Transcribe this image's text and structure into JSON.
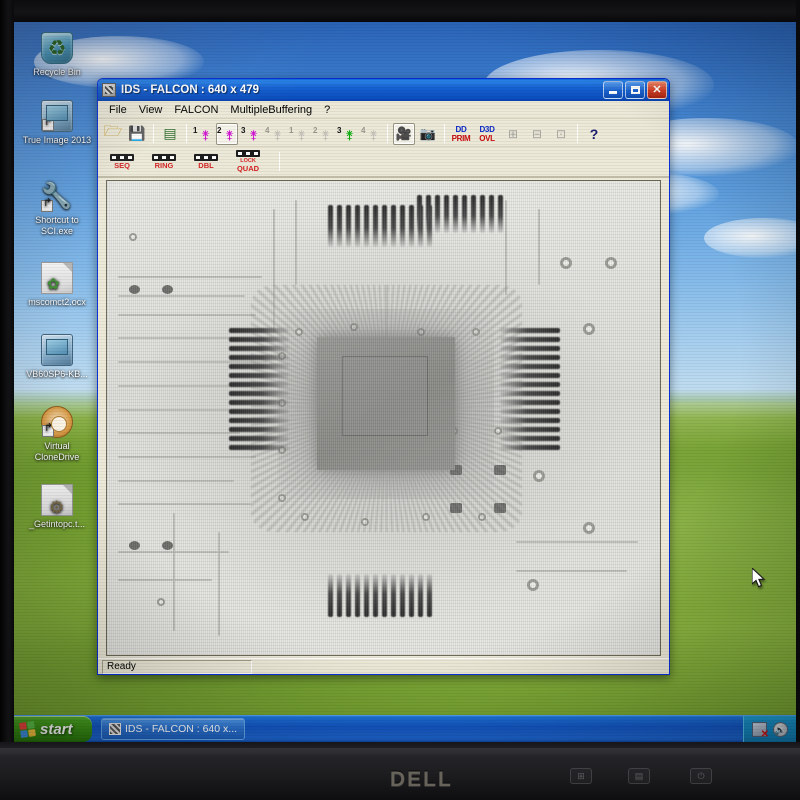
{
  "photo": {
    "monitor_brand": "DELL",
    "bezel_buttons": [
      "input-select",
      "menu",
      "power"
    ]
  },
  "desktop": {
    "icons": [
      {
        "label": "Recycle Bin",
        "icon": "recycle-bin-icon",
        "shortcut": false
      },
      {
        "label": "True Image 2013",
        "icon": "acronis-true-image-icon",
        "shortcut": true
      },
      {
        "label": "Shortcut to SCI.exe",
        "icon": "wrench-icon",
        "shortcut": true
      },
      {
        "label": "mscomct2.ocx",
        "icon": "ocx-file-icon",
        "shortcut": false
      },
      {
        "label": "VB60SP6-KB...",
        "icon": "installer-icon",
        "shortcut": false
      },
      {
        "label": "Virtual CloneDrive",
        "icon": "virtual-clonedrive-icon",
        "shortcut": true
      },
      {
        "label": "_Getintopc.t...",
        "icon": "text-file-icon",
        "shortcut": false
      }
    ]
  },
  "window": {
    "title": "IDS - FALCON : 640 x 479",
    "icon": "falcon-app-icon",
    "controls": {
      "minimize": "Minimize",
      "maximize": "Maximize",
      "close": "Close"
    },
    "menu": [
      "File",
      "View",
      "FALCON",
      "MultipleBuffering",
      "?"
    ],
    "toolbar_row1": [
      {
        "name": "open-button",
        "icon": "folder-open-icon",
        "label": "",
        "state": "normal"
      },
      {
        "name": "save-button",
        "icon": "floppy-disk-icon",
        "label": "",
        "state": "normal"
      },
      {
        "name": "grabber-button",
        "icon": "frame-grabber-icon",
        "label": "",
        "state": "normal"
      },
      {
        "name": "camera-1-magenta",
        "icon": "camera-icon",
        "label": "1",
        "state": "active",
        "color": "magenta"
      },
      {
        "name": "camera-2-magenta",
        "icon": "camera-icon",
        "label": "2",
        "state": "pressed",
        "color": "magenta"
      },
      {
        "name": "camera-3-magenta",
        "icon": "camera-icon",
        "label": "3",
        "state": "active",
        "color": "magenta"
      },
      {
        "name": "camera-4-magenta",
        "icon": "camera-icon",
        "label": "4",
        "state": "disabled",
        "color": "grey"
      },
      {
        "name": "camera-1-green",
        "icon": "camera-icon",
        "label": "1",
        "state": "disabled",
        "color": "grey"
      },
      {
        "name": "camera-2-green",
        "icon": "camera-icon",
        "label": "2",
        "state": "disabled",
        "color": "grey"
      },
      {
        "name": "camera-3-green",
        "icon": "camera-icon",
        "label": "3",
        "state": "active",
        "color": "green"
      },
      {
        "name": "camera-4-green",
        "icon": "camera-icon",
        "label": "4",
        "state": "disabled",
        "color": "grey"
      },
      {
        "name": "live-video-button",
        "icon": "camera-live-icon",
        "label": "",
        "state": "pressed"
      },
      {
        "name": "snapshot-button",
        "icon": "camera-snapshot-icon",
        "label": "",
        "state": "normal"
      },
      {
        "name": "dd-prim-button",
        "icon": "directdraw-icon",
        "label_top": "DD",
        "label_bottom": "PRIM",
        "state": "normal"
      },
      {
        "name": "d3d-ovl-button",
        "icon": "direct3d-icon",
        "label_top": "D3D",
        "label_bottom": "OVL",
        "state": "normal"
      },
      {
        "name": "display-mode-1-button",
        "icon": "display-mode-icon",
        "label": "",
        "state": "disabled"
      },
      {
        "name": "display-mode-2-button",
        "icon": "display-mode-icon",
        "label": "",
        "state": "disabled"
      },
      {
        "name": "display-mode-3-button",
        "icon": "display-fit-icon",
        "label": "",
        "state": "disabled"
      },
      {
        "name": "help-button",
        "icon": "help-question-icon",
        "label": "",
        "state": "normal"
      }
    ],
    "toolbar_row2": [
      {
        "name": "seq-button",
        "cap": "SEQ",
        "cap_small": "",
        "icon": "filmstrip-icon"
      },
      {
        "name": "ring-button",
        "cap": "RING",
        "cap_small": "",
        "icon": "filmstrip-icon"
      },
      {
        "name": "dbl-button",
        "cap": "DBL",
        "cap_small": "",
        "icon": "filmstrip-icon"
      },
      {
        "name": "quad-button",
        "cap": "QUAD",
        "cap_small": "LOCK",
        "icon": "filmstrip-icon"
      }
    ],
    "statusbar": {
      "message": "Ready"
    },
    "image_view": {
      "description": "X-ray grayscale image of a printed circuit board with a centered QFP integrated circuit, gull-wing lead combs on all four sides, plated through-hole vias and routed copper traces",
      "resolution": "640 x 479"
    }
  },
  "taskbar": {
    "start_label": "start",
    "tasks": [
      {
        "label": "IDS - FALCON : 640 x...",
        "icon": "falcon-app-icon",
        "active": true
      }
    ],
    "tray": [
      {
        "name": "network-disconnected-icon",
        "title": "Network"
      },
      {
        "name": "volume-icon",
        "title": "Volume"
      }
    ]
  },
  "colors": {
    "title_blue": "#0a4cbd",
    "taskbar_blue": "#1357c4",
    "start_green": "#378c14",
    "face": "#ece9d8",
    "accent_red": "#d32020",
    "magenta": "#d318d3",
    "green": "#12b012"
  }
}
